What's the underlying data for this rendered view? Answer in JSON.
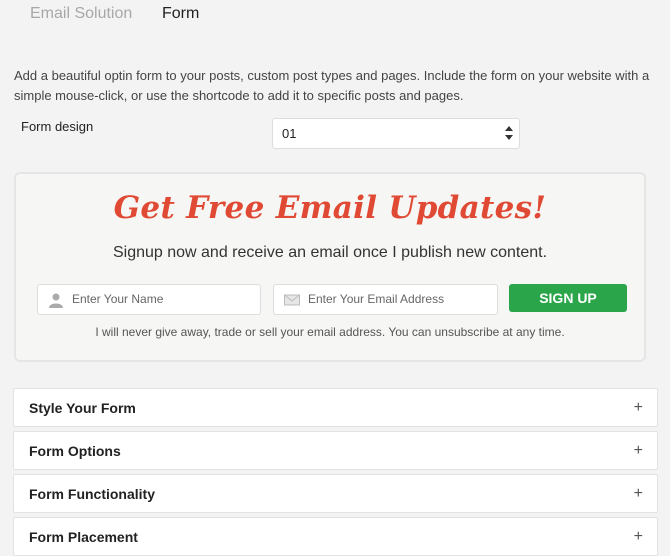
{
  "tabs": [
    {
      "label": "Email Solution",
      "active": false
    },
    {
      "label": "Form",
      "active": true
    }
  ],
  "description": "Add a beautiful optin form to your posts, custom post types and pages. Include the form on your website with a simple mouse-click, or use the shortcode to add it to specific posts and pages.",
  "form_design": {
    "label": "Form design",
    "selected": "01"
  },
  "preview": {
    "headline": "Get Free Email Updates!",
    "subheadline": "Signup now and receive an email once I publish new content.",
    "name_placeholder": "Enter Your Name",
    "email_placeholder": "Enter Your Email Address",
    "signup_label": "SIGN UP",
    "privacy_note": "I will never give away, trade or sell your email address. You can unsubscribe at any time.",
    "headline_color": "#e04a35",
    "button_color": "#2aa549"
  },
  "sections": [
    {
      "label": "Style Your Form",
      "toggle": "+"
    },
    {
      "label": "Form Options",
      "toggle": "+"
    },
    {
      "label": "Form Functionality",
      "toggle": "+"
    },
    {
      "label": "Form Placement",
      "toggle": "+"
    }
  ]
}
